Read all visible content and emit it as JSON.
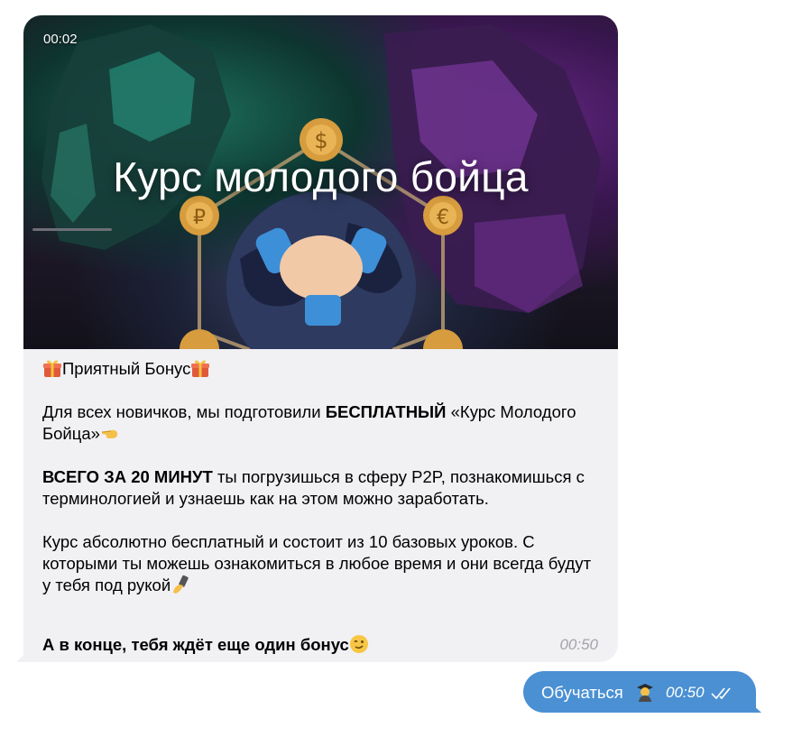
{
  "incoming_message": {
    "media": {
      "duration": "00:02",
      "title": "Курс молодого бойца"
    },
    "header": "Приятный Бонус",
    "paragraph1_before": "Для всех новичков, мы подготовили ",
    "paragraph1_bold": "БЕСПЛАТНЫЙ",
    "paragraph1_after": " «Курс Молодого Бойца»",
    "paragraph2_bold": "ВСЕГО ЗА 20 МИНУТ",
    "paragraph2_after": " ты погрузишься в сферу P2P, познакомишься с терминологией и узнаешь как на этом можно заработать.",
    "paragraph3": "Курс абсолютно бесплатный и состоит из 10 базовых уроков. С которыми ты можешь ознакомиться в любое время и они всегда будут у тебя под рукой",
    "last_line": "А в конце, тебя ждёт еще один бонус",
    "time": "00:50",
    "icons": [
      "gift-icon",
      "pointing-left-icon",
      "selfie-hand-icon",
      "wink-face-icon"
    ]
  },
  "outgoing_message": {
    "label": "Обучаться",
    "time": "00:50",
    "icons": [
      "student-icon",
      "double-check-icon"
    ]
  },
  "colors": {
    "incoming_bubble": "#f1f1f4",
    "outgoing_bubble": "#4a90d3",
    "time_grey": "#a3a3ab"
  }
}
